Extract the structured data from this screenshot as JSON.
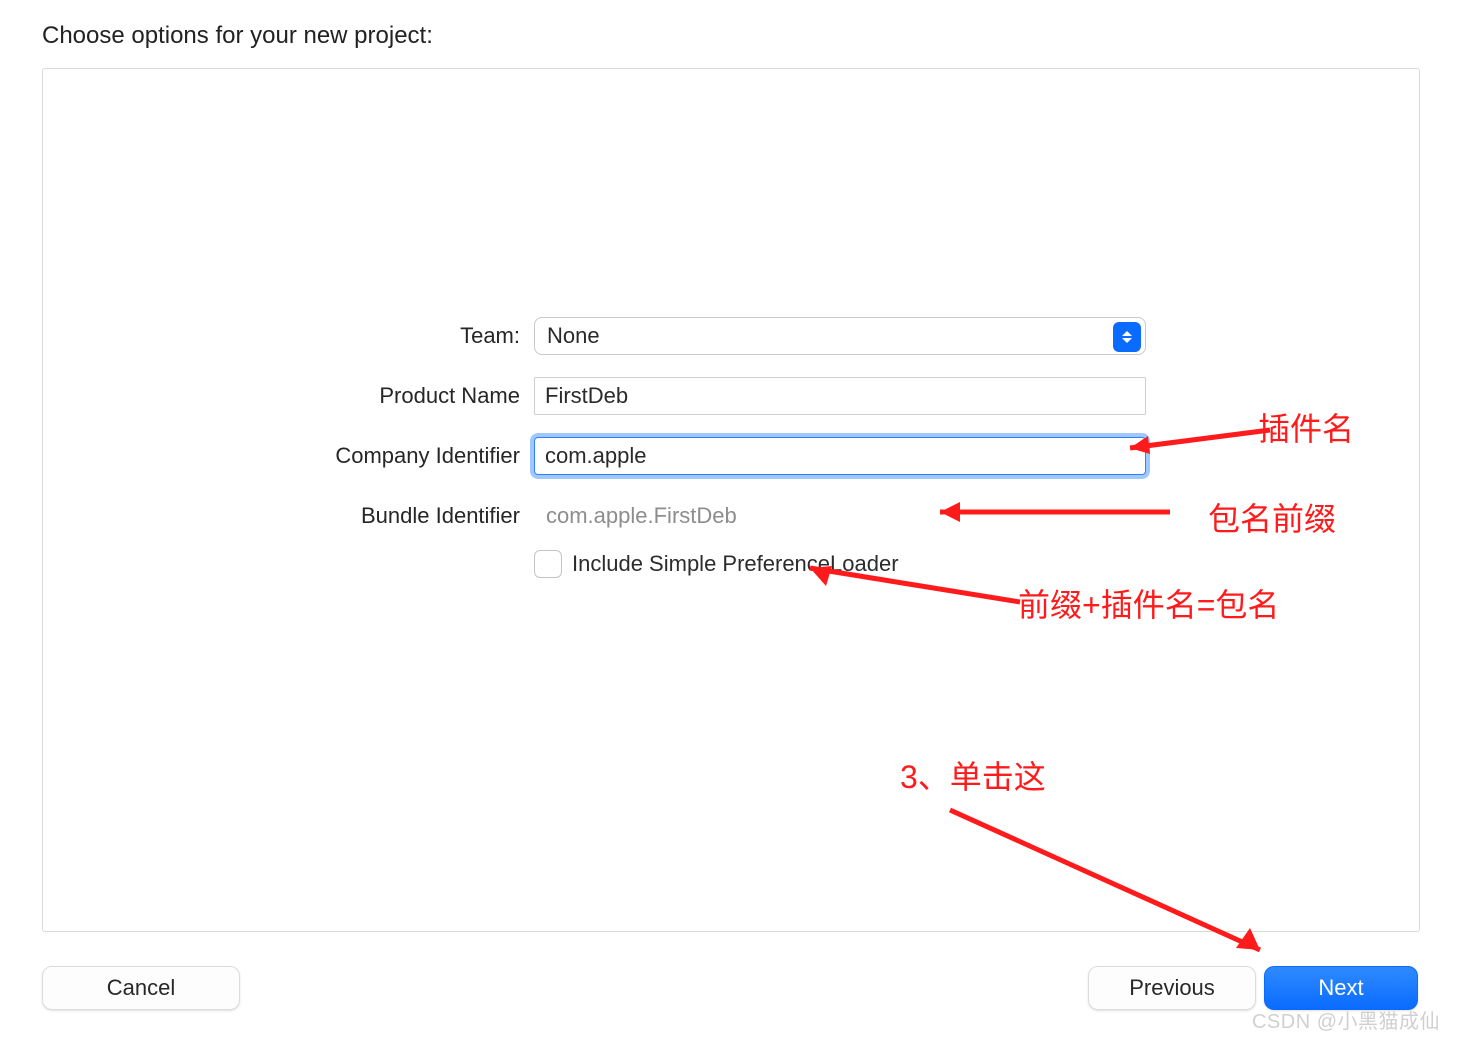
{
  "title": "Choose options for your new project:",
  "form": {
    "team_label": "Team:",
    "team_value": "None",
    "product_name_label": "Product Name",
    "product_name_value": "FirstDeb",
    "company_id_label": "Company Identifier",
    "company_id_value": "com.apple",
    "bundle_id_label": "Bundle Identifier",
    "bundle_id_value": "com.apple.FirstDeb",
    "checkbox_label": "Include Simple PreferenceLoader",
    "checkbox_checked": false
  },
  "buttons": {
    "cancel": "Cancel",
    "previous": "Previous",
    "next": "Next"
  },
  "annotations": {
    "plugin_name": "插件名",
    "pkg_prefix": "包名前缀",
    "prefix_plus_plugin": "前缀+插件名=包名",
    "click_here": "3、单击这"
  },
  "watermark": "CSDN @小黑猫成仙"
}
